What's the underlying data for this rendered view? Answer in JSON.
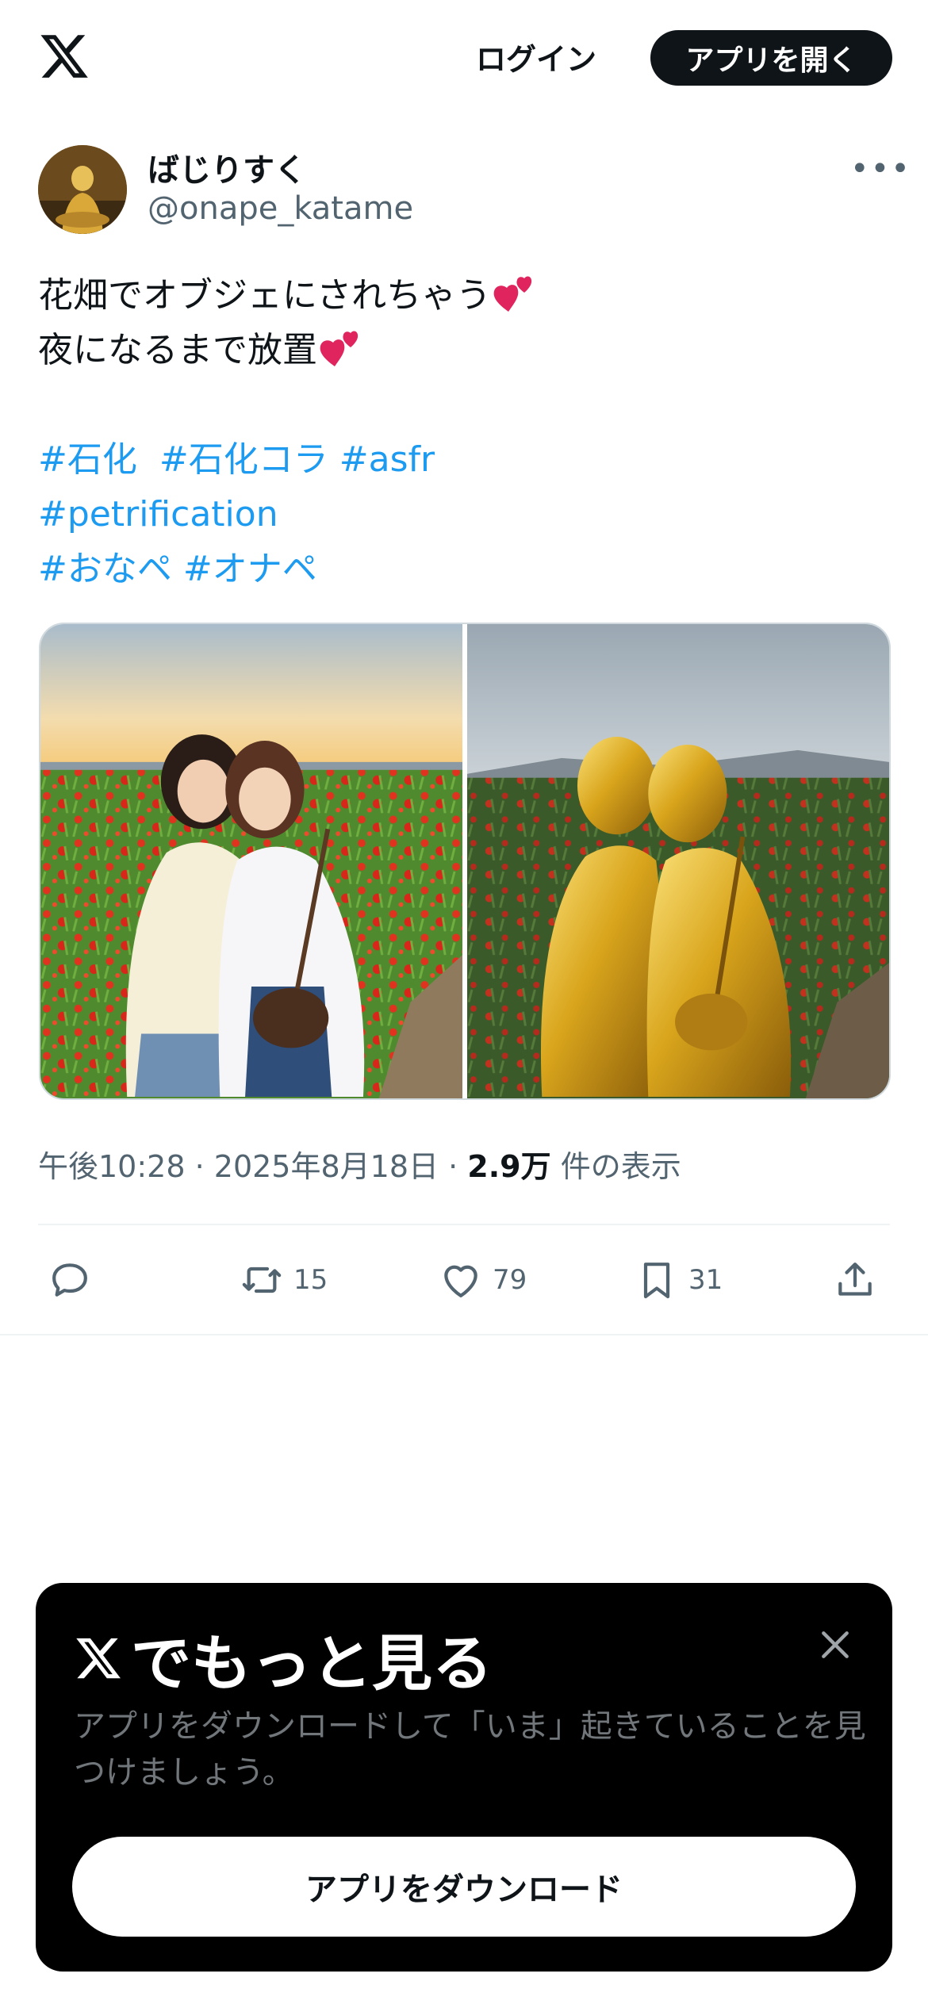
{
  "header": {
    "logo_icon": "x-logo-icon",
    "login_label": "ログイン",
    "open_app_label": "アプリを開く"
  },
  "tweet": {
    "author_name": "ばじりすく",
    "author_handle": "@onape_katame",
    "text_line1": "花畑でオブジェにされちゃう",
    "text_line2": "夜になるまで放置",
    "hashtags_row1": [
      "#石化",
      "#石化コラ",
      "#asfr"
    ],
    "hashtags_row2": [
      "#petrification"
    ],
    "hashtags_row3": [
      "#おなペ",
      "#オナペ"
    ],
    "time": "午後10:28",
    "date": "2025年8月18日",
    "views_count": "2.9万",
    "views_label": "件の表示",
    "replies_count": "",
    "retweets_count": "15",
    "likes_count": "79",
    "bookmarks_count": "31"
  },
  "promo": {
    "title": "でもっと見る",
    "description": "アプリをダウンロードして「いま」起きていることを見つけましょう。",
    "download_label": "アプリをダウンロード"
  },
  "colors": {
    "accent": "#1d9bf0",
    "text": "#0f1419",
    "muted": "#536471",
    "heart": "#e0245e"
  }
}
